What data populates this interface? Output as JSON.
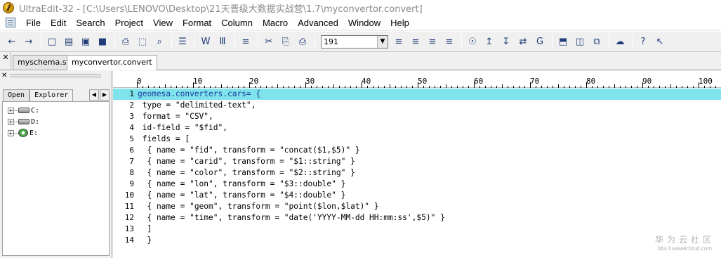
{
  "window": {
    "title": "UltraEdit-32 - [C:\\Users\\LENOVO\\Desktop\\21天晋级大数据实战营\\1.7\\myconvertor.convert]"
  },
  "menu": [
    "File",
    "Edit",
    "Search",
    "Project",
    "View",
    "Format",
    "Column",
    "Macro",
    "Advanced",
    "Window",
    "Help"
  ],
  "toolbar": {
    "buttons": [
      {
        "name": "back-arrow-icon",
        "glyph": "←"
      },
      {
        "name": "forward-arrow-icon",
        "glyph": "→"
      },
      {
        "name": "new-file-icon",
        "glyph": "□"
      },
      {
        "name": "open-folder-icon",
        "glyph": "▤"
      },
      {
        "name": "close-file-icon",
        "glyph": "▣"
      },
      {
        "name": "save-icon",
        "glyph": "■"
      },
      {
        "name": "print-icon",
        "glyph": "⎙"
      },
      {
        "name": "print-preview-icon",
        "glyph": "⬚"
      },
      {
        "name": "find-files-icon",
        "glyph": "⌕"
      },
      {
        "name": "properties-icon",
        "glyph": "☰"
      },
      {
        "name": "word-wrap-icon",
        "glyph": "W"
      },
      {
        "name": "hex-mode-icon",
        "glyph": "Ⅲ"
      },
      {
        "name": "format-icon",
        "glyph": "≡"
      },
      {
        "name": "cut-icon",
        "glyph": "✂"
      },
      {
        "name": "copy-icon",
        "glyph": "⎘"
      },
      {
        "name": "paste-icon",
        "glyph": "⎙"
      }
    ],
    "combo_value": "191",
    "buttons_after": [
      {
        "name": "align-left-icon",
        "glyph": "≡"
      },
      {
        "name": "align-center-icon",
        "glyph": "≡"
      },
      {
        "name": "align-right-icon",
        "glyph": "≡"
      },
      {
        "name": "justify-icon",
        "glyph": "≡"
      },
      {
        "name": "find-icon",
        "glyph": "☉"
      },
      {
        "name": "find-prev-icon",
        "glyph": "↥"
      },
      {
        "name": "find-next-icon",
        "glyph": "↧"
      },
      {
        "name": "replace-icon",
        "glyph": "⇄"
      },
      {
        "name": "goto-icon",
        "glyph": "G"
      },
      {
        "name": "split-horizontal-icon",
        "glyph": "⬒"
      },
      {
        "name": "split-vertical-icon",
        "glyph": "◫"
      },
      {
        "name": "cascade-icon",
        "glyph": "⧉"
      },
      {
        "name": "ftp-icon",
        "glyph": "☁"
      },
      {
        "name": "help-icon",
        "glyph": "?"
      },
      {
        "name": "context-help-icon",
        "glyph": "↖"
      }
    ]
  },
  "tabs": [
    {
      "label": "myschema.sft",
      "active": false
    },
    {
      "label": "myconvertor.convert",
      "active": true
    }
  ],
  "left_panel": {
    "tabs": [
      "Open",
      "Explorer"
    ],
    "active_tab": "Explorer",
    "drives": [
      {
        "label": "C:",
        "type": "disk"
      },
      {
        "label": "D:",
        "type": "disk"
      },
      {
        "label": "E:",
        "type": "cd"
      }
    ]
  },
  "ruler": [
    "0",
    "10",
    "20",
    "30",
    "40",
    "50",
    "60",
    "70",
    "80",
    "90",
    "100"
  ],
  "code": {
    "current_line": 1,
    "lines": [
      "geomesa.converters.cars= {",
      " type = \"delimited-text\",",
      " format = \"CSV\",",
      " id-field = \"$fid\",",
      " fields = [",
      "  { name = \"fid\", transform = \"concat($1,$5)\" }",
      "  { name = \"carid\", transform = \"$1::string\" }",
      "  { name = \"color\", transform = \"$2::string\" }",
      "  { name = \"lon\", transform = \"$3::double\" }",
      "  { name = \"lat\", transform = \"$4::double\" }",
      "  { name = \"geom\", transform = \"point($lon,$lat)\" }",
      "  { name = \"time\", transform = \"date('YYYY-MM-dd HH:mm:ss',$5)\" }",
      "  ]",
      "  }"
    ]
  },
  "watermark": {
    "title": "华为云社区",
    "url": "bbs.huaweicloud.com"
  }
}
